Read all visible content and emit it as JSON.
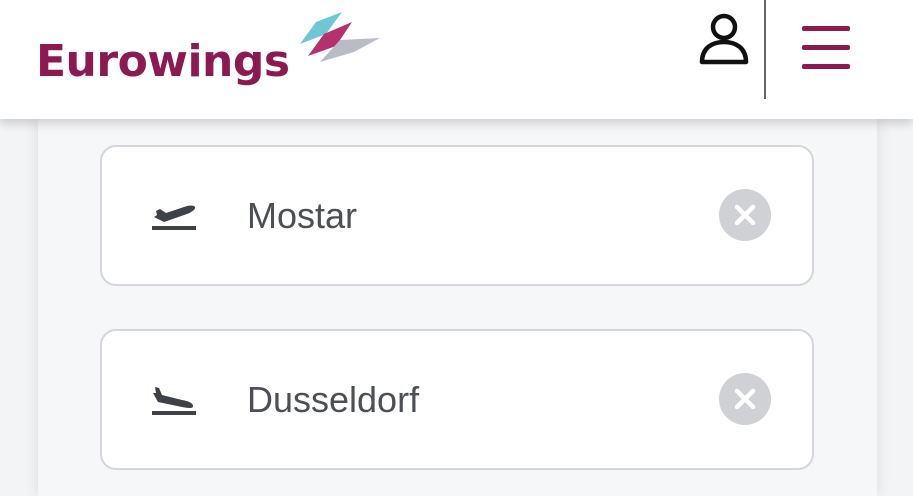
{
  "header": {
    "logo_text": "Eurowings",
    "brand_color": "#8a1a4f",
    "profile_icon": "user-icon",
    "menu_icon": "hamburger-menu-icon"
  },
  "search": {
    "origin": {
      "icon": "plane-departure-icon",
      "value": "Mostar",
      "clear_icon": "clear-icon"
    },
    "destination": {
      "icon": "plane-arrival-icon",
      "value": "Dusseldorf",
      "clear_icon": "clear-icon"
    }
  }
}
